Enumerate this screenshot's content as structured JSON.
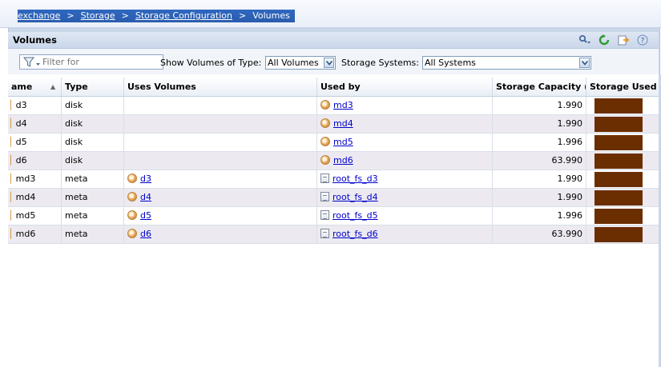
{
  "breadcrumb": {
    "items": [
      {
        "label": "exchange",
        "link": true
      },
      {
        "label": "Storage",
        "link": true
      },
      {
        "label": "Storage Configuration",
        "link": true
      },
      {
        "label": "Volumes",
        "link": false
      }
    ],
    "separator": ">"
  },
  "panel": {
    "title": "Volumes",
    "tools": [
      "search-options-icon",
      "refresh-icon",
      "export-icon",
      "help-icon"
    ]
  },
  "toolbar": {
    "filter_placeholder": "Filter for",
    "type_label": "Show Volumes of Type:",
    "type_value": "All Volumes",
    "systems_label": "Storage Systems:",
    "systems_value": "All Systems"
  },
  "table": {
    "columns": [
      "ame",
      "Type",
      "Uses Volumes",
      "Used by",
      "Storage Capacity (...",
      "Storage Used"
    ],
    "sort_indicator": "▲",
    "rows": [
      {
        "name": "d3",
        "type": "disk",
        "uses": "",
        "uses_icon": "",
        "used_by": "md3",
        "used_by_icon": "volume-icon",
        "capacity": "1.990",
        "used_fraction": 1.0
      },
      {
        "name": "d4",
        "type": "disk",
        "uses": "",
        "uses_icon": "",
        "used_by": "md4",
        "used_by_icon": "volume-icon",
        "capacity": "1.990",
        "used_fraction": 1.0
      },
      {
        "name": "d5",
        "type": "disk",
        "uses": "",
        "uses_icon": "",
        "used_by": "md5",
        "used_by_icon": "volume-icon",
        "capacity": "1.996",
        "used_fraction": 1.0
      },
      {
        "name": "d6",
        "type": "disk",
        "uses": "",
        "uses_icon": "",
        "used_by": "md6",
        "used_by_icon": "volume-icon",
        "capacity": "63.990",
        "used_fraction": 1.0
      },
      {
        "name": "md3",
        "type": "meta",
        "uses": "d3",
        "uses_icon": "volume-icon",
        "used_by": "root_fs_d3",
        "used_by_icon": "filesystem-icon",
        "capacity": "1.990",
        "used_fraction": 1.0
      },
      {
        "name": "md4",
        "type": "meta",
        "uses": "d4",
        "uses_icon": "volume-icon",
        "used_by": "root_fs_d4",
        "used_by_icon": "filesystem-icon",
        "capacity": "1.990",
        "used_fraction": 1.0
      },
      {
        "name": "md5",
        "type": "meta",
        "uses": "d5",
        "uses_icon": "volume-icon",
        "used_by": "root_fs_d5",
        "used_by_icon": "filesystem-icon",
        "capacity": "1.996",
        "used_fraction": 1.0
      },
      {
        "name": "md6",
        "type": "meta",
        "uses": "d6",
        "uses_icon": "volume-icon",
        "used_by": "root_fs_d6",
        "used_by_icon": "filesystem-icon",
        "capacity": "63.990",
        "used_fraction": 1.0
      }
    ]
  },
  "colors": {
    "accent": "#2f68c0",
    "used_bar": "#6b2e00",
    "alt_row": "#eceaf0",
    "link": "#0000cc"
  }
}
